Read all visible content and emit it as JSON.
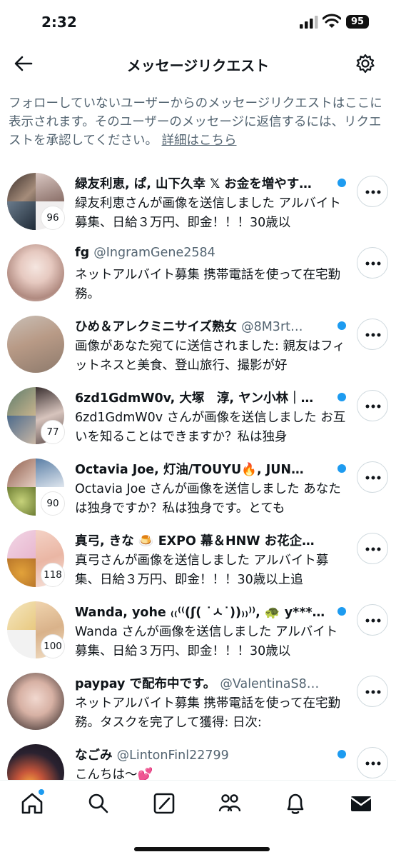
{
  "status_bar": {
    "time": "2:32",
    "battery": "95"
  },
  "header": {
    "title": "メッセージリクエスト"
  },
  "description": {
    "text": "フォローしていないユーザーからのメッセージリクエストはここに表示されます。そのユーザーのメッセージに返信するには、リクエストを承認してください。",
    "link": "詳細はこちら"
  },
  "messages": [
    {
      "names": "緑友利恵, ぱ, 山下久幸 𝕏 お金を増やす…",
      "handle": "",
      "preview": "緑友利恵さんが画像を送信しました アルバイト募集、日給３万円、即金！！！30歳以",
      "badge": "96"
    },
    {
      "names": "fg",
      "handle": "@IngramGene2584",
      "preview": "ネットアルバイト募集 携帯電話を使って在宅勤務。",
      "badge": ""
    },
    {
      "names": "ひめ＆アレクミニサイズ熟女",
      "handle": "@8M3rt…",
      "preview": "画像があなた宛てに送信されました: 親友はフィットネスと美食、登山旅行、撮影が好",
      "badge": ""
    },
    {
      "names": "6zd1GdmW0v, 大塚　淳, ヤン小林｜…",
      "handle": "",
      "preview": "6zd1GdmW0v さんが画像を送信しました お互いを知ることはできますか？私は独身",
      "badge": "77"
    },
    {
      "names": "Octavia Joe, 灯油/TOUYU🔥, JUN…",
      "handle": "",
      "preview": "Octavia Joe さんが画像を送信しました あなたは独身ですか？私は独身です。とても",
      "badge": "90"
    },
    {
      "names": "真弓, きな 🍮 EXPO 幕＆HNW お花企…",
      "handle": "",
      "preview": "真弓さんが画像を送信しました アルバイト募集、日給３万円、即金！！！30歳以上追",
      "badge": "118"
    },
    {
      "names": "Wanda, yohe ₍₍⁽⁽(ʃ( ˙ㅅ˙))₎₎⁾⁾, 🐢 y***…",
      "handle": "",
      "preview": "Wanda さんが画像を送信しました アルバイト募集、日給３万円、即金！！！30歳以",
      "badge": "100"
    },
    {
      "names": "paypay で配布中です。",
      "handle": "@ValentinaS8…",
      "preview": "ネットアルバイト募集 携帯電話を使って在宅勤務。タスクを完了して獲得: 日次:",
      "badge": ""
    },
    {
      "names": "なごみ",
      "handle": "@LintonFinl22799",
      "preview": "こんちは〜💕",
      "badge": ""
    }
  ],
  "colors": {
    "accent": "#1d9bf0",
    "secondary_text": "#536471",
    "border": "#cfd9de"
  },
  "tab_bar": [
    "home-icon",
    "search-icon",
    "grok-icon",
    "communities-icon",
    "notifications-icon",
    "messages-icon"
  ]
}
